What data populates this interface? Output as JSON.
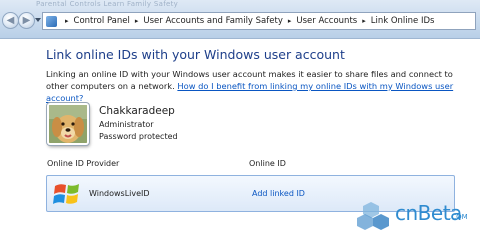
{
  "ghost_title": "Parental Controls Learn Family Safety",
  "nav": {
    "back_glyph": "◀",
    "forward_glyph": "▶",
    "breadcrumbs": [
      "Control Panel",
      "User Accounts and Family Safety",
      "User Accounts",
      "Link Online IDs"
    ],
    "separator": "▸"
  },
  "main": {
    "heading": "Link online IDs with your Windows user account",
    "description": "Linking an online ID with your Windows user account makes it easier to share files and connect to other computers on a network.",
    "help_link": "How do I benefit from linking my online IDs with my Windows user account?"
  },
  "user": {
    "name": "Chakkaradeep",
    "role": "Administrator",
    "password_status": "Password protected"
  },
  "table": {
    "headers": [
      "Online ID Provider",
      "Online ID"
    ],
    "rows": [
      {
        "provider": "WindowsLiveID",
        "action": "Add linked ID"
      }
    ]
  },
  "watermark": {
    "text": "cnBeta",
    "suffix": ".COM"
  },
  "colors": {
    "heading": "#1e3f8a",
    "link": "#0a56c2",
    "row_border": "#8fb2df",
    "watermark": "#2f8bd0"
  }
}
